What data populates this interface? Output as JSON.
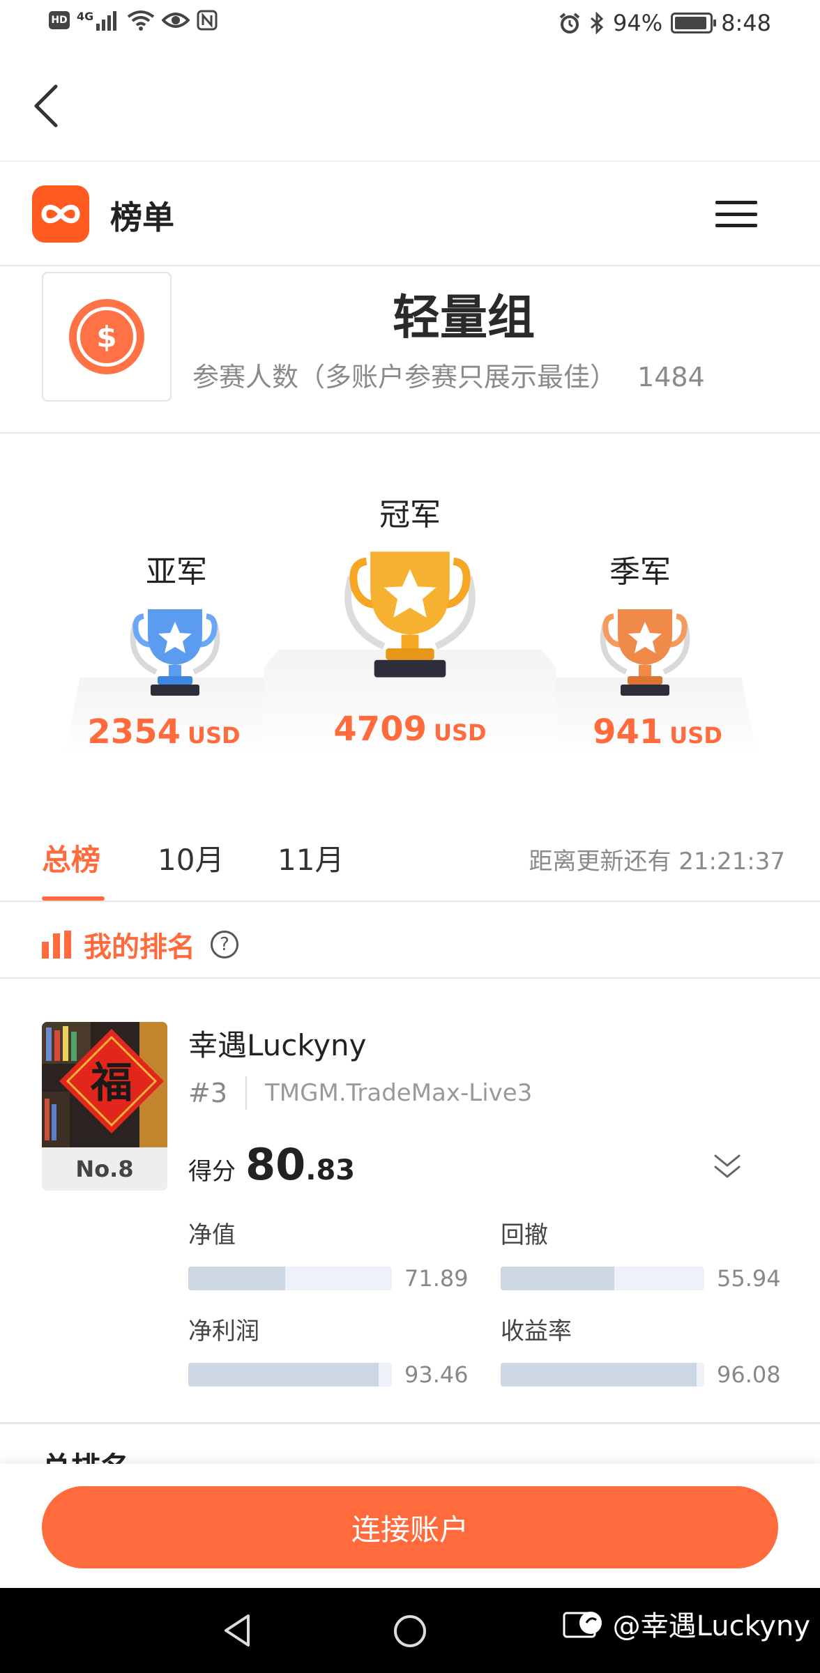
{
  "status_bar": {
    "network": "4G",
    "hd": "HD",
    "battery": "94%",
    "time": "8:48"
  },
  "header": {
    "title": "榜单"
  },
  "group": {
    "title": "轻量组",
    "participants_label": "参赛人数（多账户参赛只展示最佳）",
    "participants_count": "1484",
    "icon_symbol": "$"
  },
  "podium": {
    "first": {
      "label": "冠军",
      "amount": "4709",
      "unit": "USD"
    },
    "second": {
      "label": "亚军",
      "amount": "2354",
      "unit": "USD"
    },
    "third": {
      "label": "季军",
      "amount": "941",
      "unit": "USD"
    }
  },
  "tabs": [
    {
      "label": "总榜",
      "active": true
    },
    {
      "label": "10月",
      "active": false
    },
    {
      "label": "11月",
      "active": false
    }
  ],
  "countdown": "距离更新还有 21:21:37",
  "my_rank": {
    "label": "我的排名",
    "help": "?"
  },
  "user": {
    "name": "幸遇Luckyny",
    "position": "#3",
    "account": "TMGM.TradeMax-Live3",
    "rank_badge": "No.8",
    "avatar_char": "福",
    "score_label": "得分",
    "score_int": "80",
    "score_dec": ".83",
    "metrics": [
      {
        "label": "净值",
        "value": "71.89",
        "fraction": 0.4766
      },
      {
        "label": "回撤",
        "value": "55.94",
        "fraction": 0.5594
      },
      {
        "label": "净利润",
        "value": "93.46",
        "fraction": 0.9346
      },
      {
        "label": "收益率",
        "value": "96.08",
        "fraction": 0.9608
      }
    ]
  },
  "total_ranking_peek": "总排名",
  "connect_button": "连接账户",
  "watermark": "@幸遇Luckyny",
  "colors": {
    "accent": "#ff6b3d",
    "logo": "#ff5a1f",
    "gold": "#f5a623",
    "silver_blue": "#5b9cf0",
    "bronze": "#f08a4b"
  }
}
